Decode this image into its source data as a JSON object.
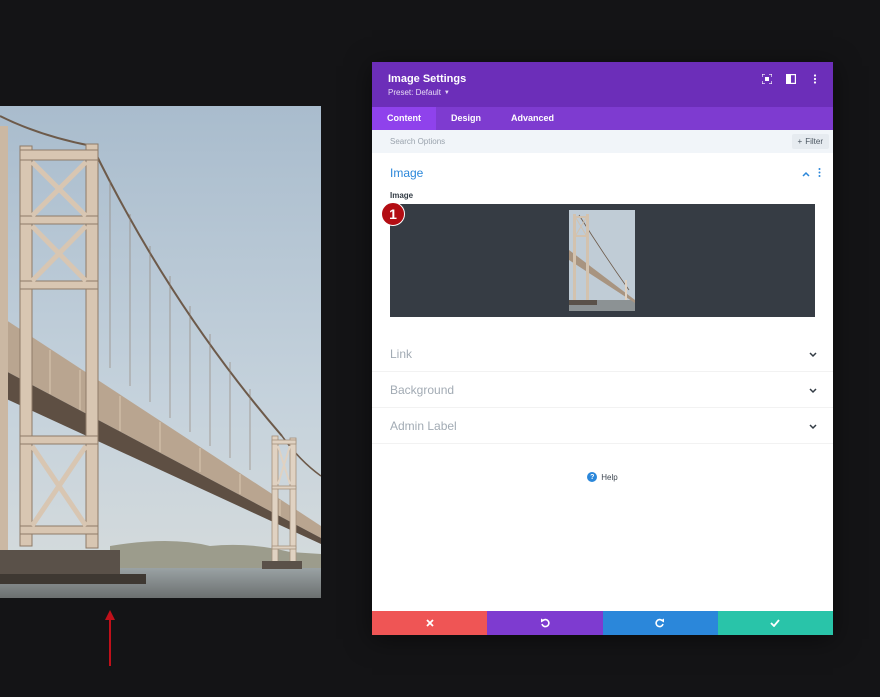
{
  "colors": {
    "background": "#141416",
    "header": "#6c2eb9",
    "tabs": "#7e3bd0",
    "active_tab": "#8f42ec",
    "accent_blue": "#2b87da",
    "discard": "#ef5555",
    "undo": "#7e3bd0",
    "redo": "#2b87da",
    "save": "#29c4a9",
    "badge": "#b30d13"
  },
  "preview": {
    "image": "bridge-photo",
    "arrow_icon": "arrow-up-icon"
  },
  "panel": {
    "title": "Image Settings",
    "preset": "Preset: Default",
    "header_icons": [
      "expand-icon",
      "sidebar-icon",
      "more-icon"
    ]
  },
  "tabs": [
    {
      "label": "Content",
      "active": true
    },
    {
      "label": "Design",
      "active": false
    },
    {
      "label": "Advanced",
      "active": false
    }
  ],
  "search": {
    "placeholder": "Search Options",
    "filter_label": "Filter"
  },
  "sections": {
    "image": {
      "title": "Image",
      "field_label": "Image",
      "badge_number": "1"
    },
    "closed": [
      {
        "label": "Link"
      },
      {
        "label": "Background"
      },
      {
        "label": "Admin Label"
      }
    ]
  },
  "help": {
    "label": "Help"
  },
  "footer": {
    "buttons": [
      "discard-button",
      "undo-button",
      "redo-button",
      "save-button"
    ]
  }
}
